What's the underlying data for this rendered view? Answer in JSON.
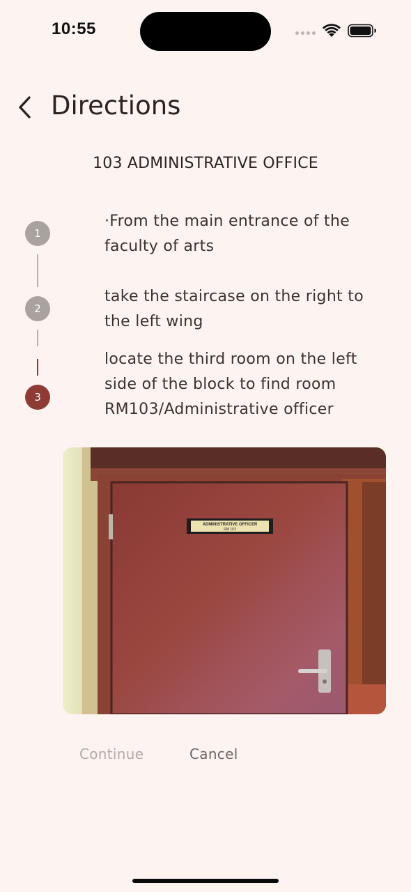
{
  "status_bar": {
    "time": "10:55",
    "signal_icon": "signal-dots-icon",
    "wifi_icon": "wifi-icon",
    "battery_icon": "battery-icon"
  },
  "header": {
    "title": "Directions",
    "back_icon": "chevron-left-icon"
  },
  "destination": "103 ADMINISTRATIVE OFFICE",
  "steps": [
    {
      "number": "1",
      "text": "·From the main entrance of the faculty of arts",
      "state": "done"
    },
    {
      "number": "2",
      "text": "take the staircase on the right to the left wing",
      "state": "done"
    },
    {
      "number": "3",
      "text": "locate the third room on the left side of the block to find room RM103/Administrative officer",
      "state": "active"
    }
  ],
  "photo": {
    "sign_line1": "ADMINISTRATIVE OFFICER",
    "sign_line2": "RM 103"
  },
  "actions": {
    "continue_label": "Continue",
    "cancel_label": "Cancel"
  },
  "colors": {
    "background": "#fdf4f2",
    "accent": "#8e3b34",
    "inactive_step": "#a9a29f"
  }
}
